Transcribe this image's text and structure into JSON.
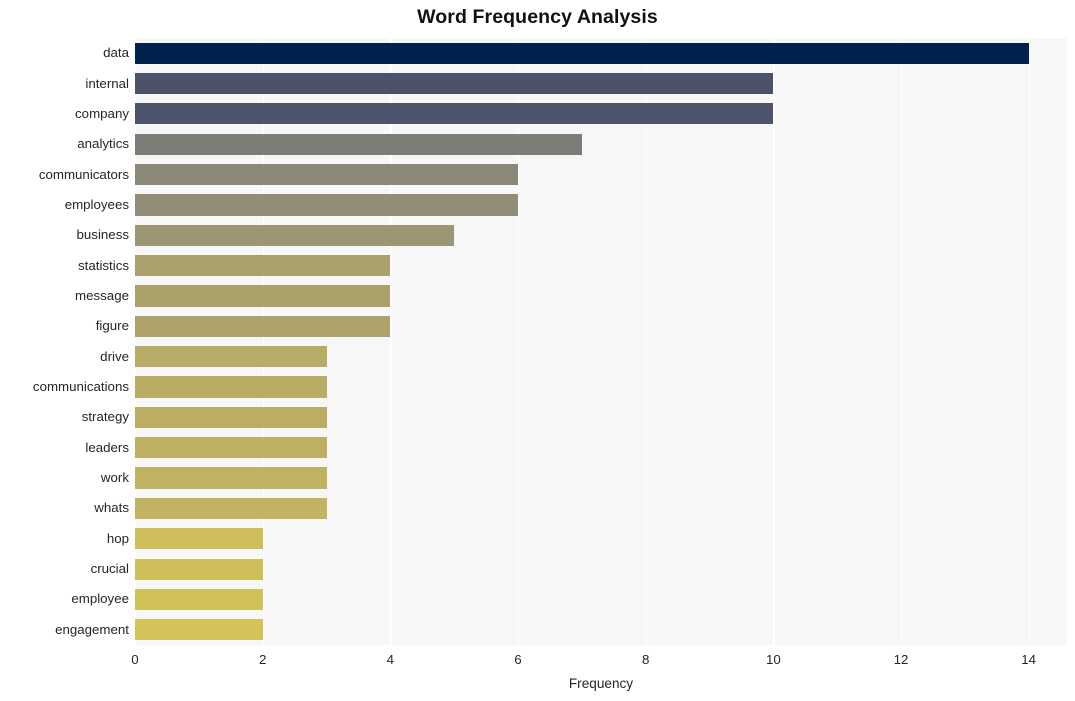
{
  "chart_data": {
    "type": "bar",
    "orientation": "horizontal",
    "title": "Word Frequency Analysis",
    "xlabel": "Frequency",
    "ylabel": "",
    "xlim": [
      0,
      14.6
    ],
    "ylim": [
      0,
      20
    ],
    "xticks": [
      0,
      2,
      4,
      6,
      8,
      10,
      12,
      14
    ],
    "xtick_labels": [
      "0",
      "2",
      "4",
      "6",
      "8",
      "10",
      "12",
      "14"
    ],
    "grid": "vertical-only",
    "legend": "none",
    "colormap": "cividis",
    "categories": [
      "data",
      "internal",
      "company",
      "analytics",
      "communicators",
      "employees",
      "business",
      "statistics",
      "message",
      "figure",
      "drive",
      "communications",
      "strategy",
      "leaders",
      "work",
      "whats",
      "hop",
      "crucial",
      "employee",
      "engagement"
    ],
    "values": [
      14,
      10,
      10,
      7,
      6,
      6,
      5,
      4,
      4,
      4,
      3,
      3,
      3,
      3,
      3,
      3,
      2,
      2,
      2,
      2
    ],
    "bar_colors": [
      "#00224e",
      "#4b5269",
      "#4d546b",
      "#7d7d78",
      "#8c8878",
      "#918d79",
      "#9c9673",
      "#a9a06c",
      "#aba16b",
      "#ada36a",
      "#b7ab66",
      "#b9ad65",
      "#bbae64",
      "#bdb063",
      "#bfb262",
      "#c1b361",
      "#cdbd5b",
      "#cfbf5a",
      "#d1c159",
      "#d3c358"
    ],
    "plot_background": "#f7f7f7",
    "gridline_color": "#ffffff",
    "figure_background": "#ffffff"
  }
}
